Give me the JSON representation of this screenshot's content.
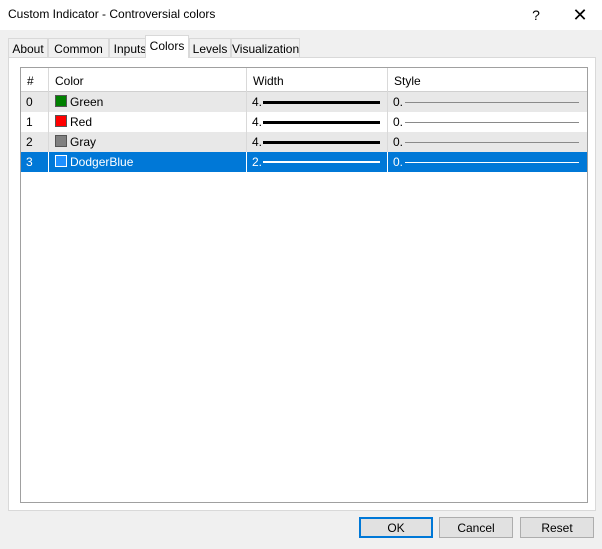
{
  "window": {
    "title": "Custom Indicator - Controversial colors",
    "help_label": "?",
    "close_label": "✕"
  },
  "tabs": [
    {
      "label": "About",
      "active": false
    },
    {
      "label": "Common",
      "active": false
    },
    {
      "label": "Inputs",
      "active": false
    },
    {
      "label": "Colors",
      "active": true
    },
    {
      "label": "Levels",
      "active": false
    },
    {
      "label": "Visualization",
      "active": false
    }
  ],
  "grid": {
    "headers": {
      "index": "#",
      "color": "Color",
      "width": "Width",
      "style": "Style"
    },
    "rows": [
      {
        "index": "0",
        "color_name": "Green",
        "swatch": "#008000",
        "width": "4.",
        "style": "0."
      },
      {
        "index": "1",
        "color_name": "Red",
        "swatch": "#ff0000",
        "width": "4.",
        "style": "0."
      },
      {
        "index": "2",
        "color_name": "Gray",
        "swatch": "#808080",
        "width": "4.",
        "style": "0."
      },
      {
        "index": "3",
        "color_name": "DodgerBlue",
        "swatch": "#1e90ff",
        "width": "2.",
        "style": "0."
      }
    ]
  },
  "buttons": {
    "ok": "OK",
    "cancel": "Cancel",
    "reset": "Reset"
  }
}
